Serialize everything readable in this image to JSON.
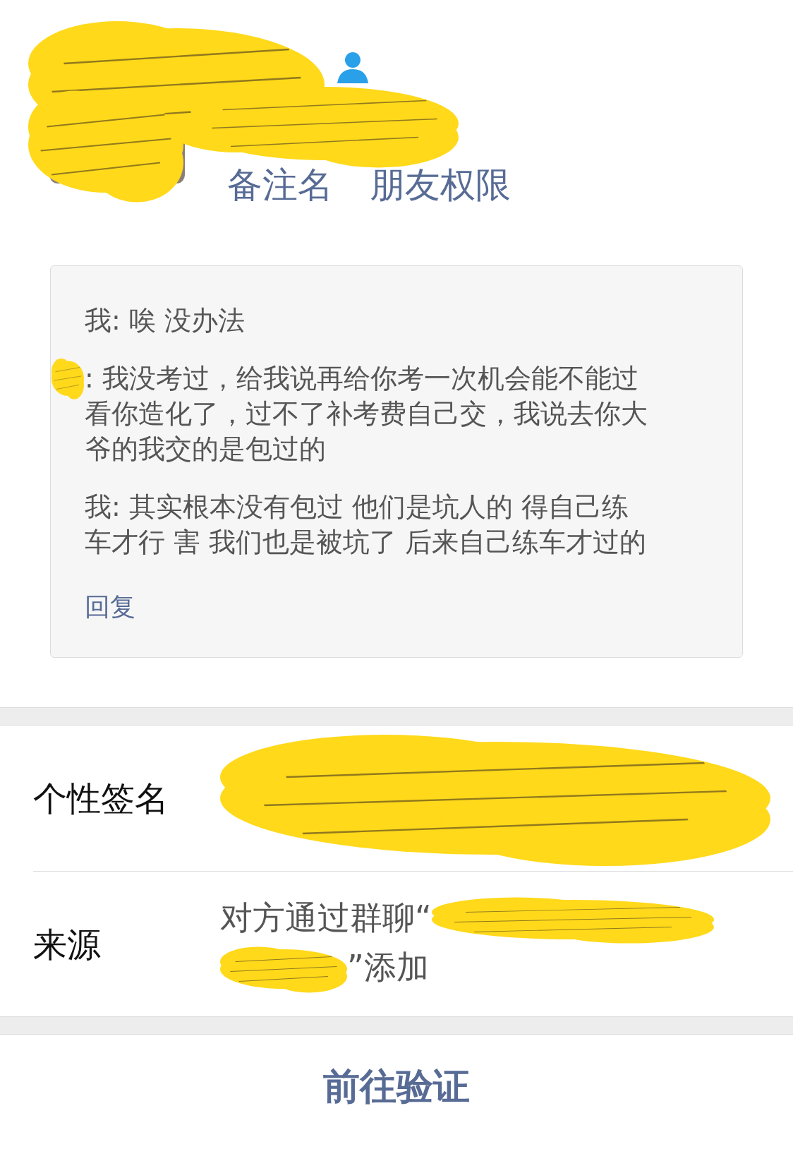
{
  "profile": {
    "links": [
      "备注名",
      "朋友权限"
    ]
  },
  "messages": [
    {
      "kind": "plain",
      "text": "我: 唉 没办法"
    },
    {
      "kind": "redacted_sender",
      "text": ": 我没考过，给我说再给你考一次机会能不能过看你造化了，过不了补考费自己交，我说去你大爷的我交的是包过的"
    },
    {
      "kind": "plain",
      "text": "我: 其实根本没有包过 他们是坑人的 得自己练车才行 害 我们也是被坑了 后来自己练车才过的"
    }
  ],
  "reply": "回复",
  "rows": [
    {
      "kind": "signature",
      "label": "个性签名"
    },
    {
      "kind": "source",
      "label": "来源",
      "before": "对方通过群聊“",
      "after": "”添加"
    }
  ],
  "button": "前往验证"
}
